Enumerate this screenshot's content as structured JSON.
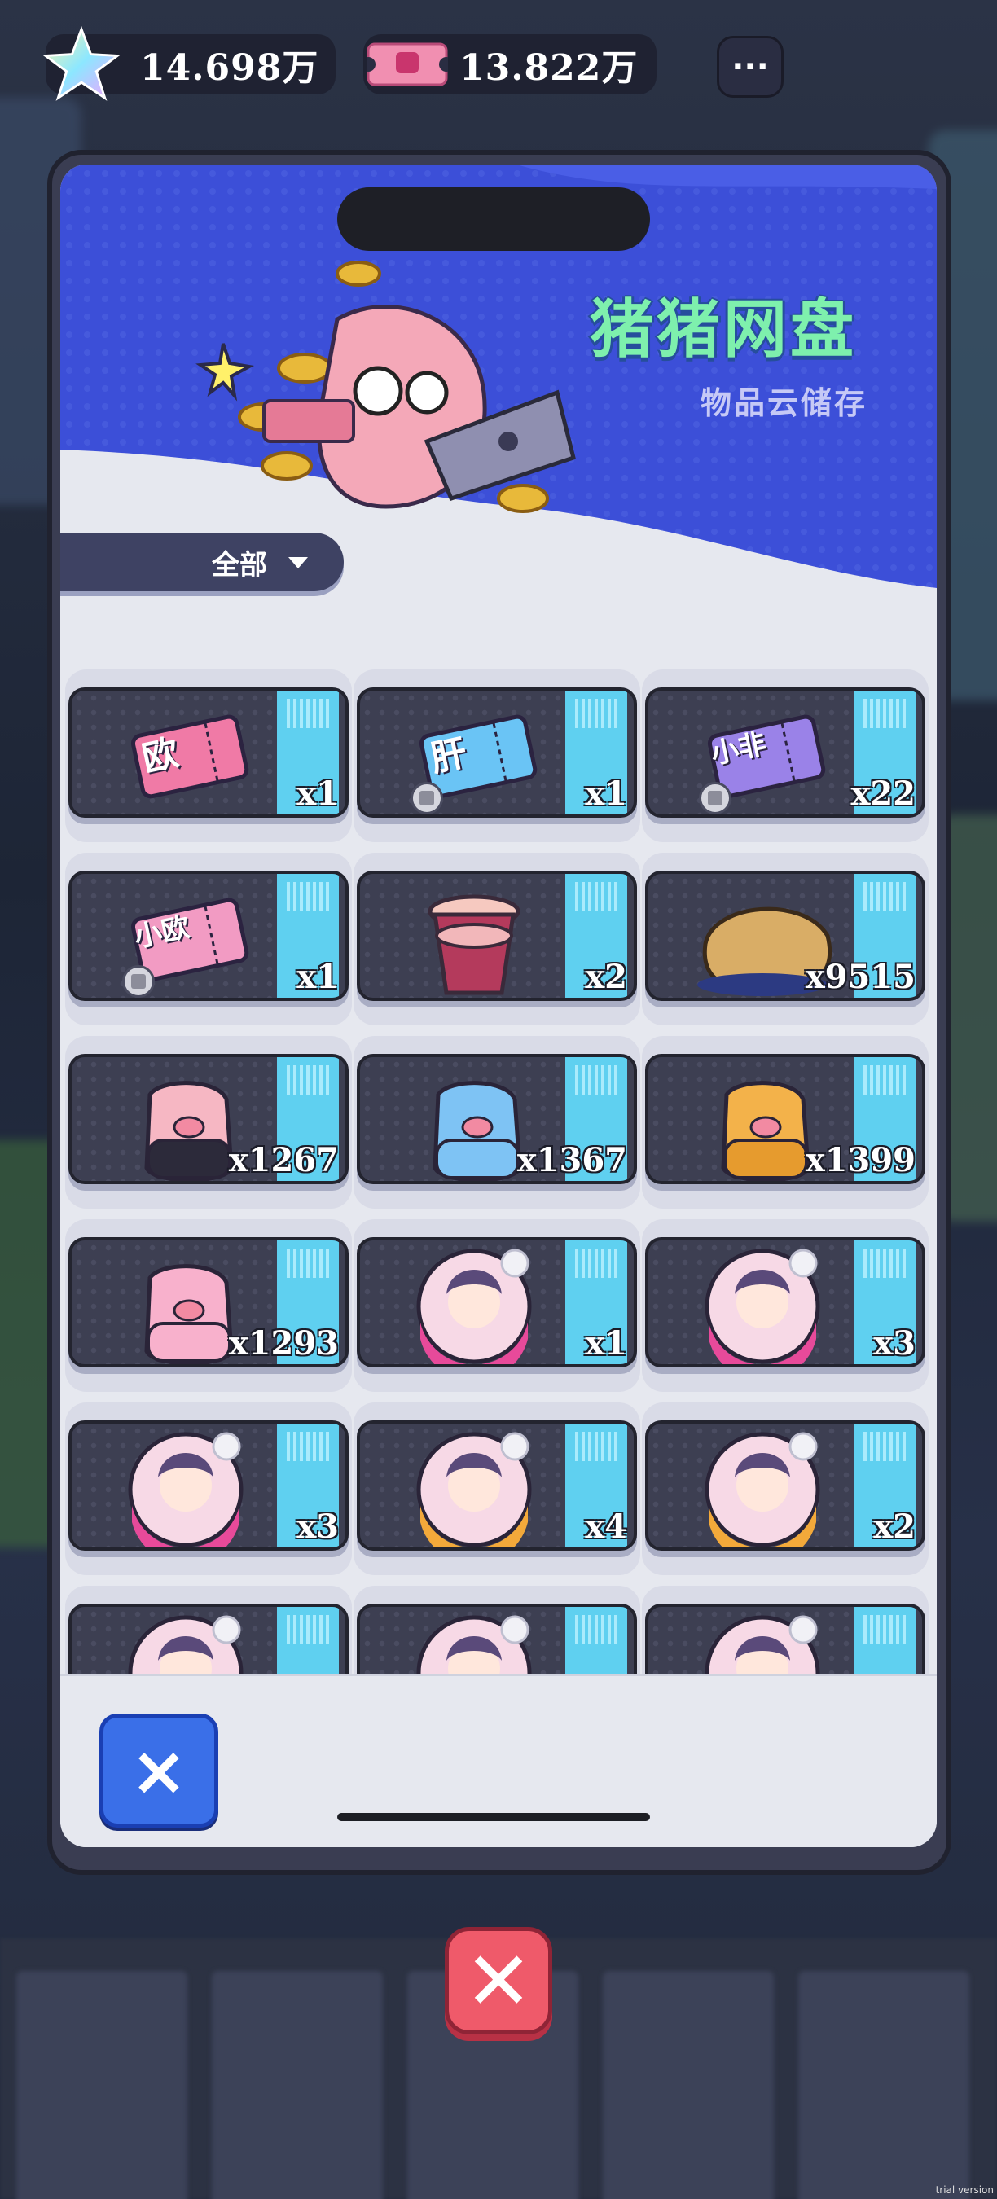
{
  "currency": {
    "stars": "14.698万",
    "tickets": "13.822万"
  },
  "more_button_label": "···",
  "panel": {
    "title": "猪猪网盘",
    "subtitle": "物品云储存",
    "filter_label": "全部"
  },
  "items": [
    {
      "name": "欧 免广 ticket",
      "qty": "x1",
      "kind": "ticket-pink",
      "ticket_text": "欧"
    },
    {
      "name": "肝 免广 ticket",
      "qty": "x1",
      "kind": "ticket-blue",
      "ticket_text": "肝"
    },
    {
      "name": "小非 免广 ticket",
      "qty": "x22",
      "kind": "ticket-purple",
      "ticket_text": "小非"
    },
    {
      "name": "小欧 免广 ticket",
      "qty": "x1",
      "kind": "ticket-lightpink",
      "ticket_text": "小欧"
    },
    {
      "name": "bubble tea",
      "qty": "x2",
      "kind": "drink"
    },
    {
      "name": "croissant",
      "qty": "x9515",
      "kind": "bread"
    },
    {
      "name": "purple pig",
      "qty": "x1267",
      "kind": "pig-purple"
    },
    {
      "name": "blue pig",
      "qty": "x1367",
      "kind": "pig-blue"
    },
    {
      "name": "yellow pig",
      "qty": "x1399",
      "kind": "pig-yellow"
    },
    {
      "name": "pink pig",
      "qty": "x1293",
      "kind": "pig-pink"
    },
    {
      "name": "character avatar",
      "qty": "x1",
      "kind": "avatar-pink"
    },
    {
      "name": "character avatar",
      "qty": "x3",
      "kind": "avatar-pink2"
    },
    {
      "name": "character avatar",
      "qty": "x3",
      "kind": "avatar-pink3"
    },
    {
      "name": "character avatar",
      "qty": "x4",
      "kind": "avatar-gold"
    },
    {
      "name": "character avatar",
      "qty": "x2",
      "kind": "avatar-gold2"
    },
    {
      "name": "character avatar",
      "qty": "",
      "kind": "avatar-pink4"
    },
    {
      "name": "character avatar",
      "qty": "",
      "kind": "avatar-gold3"
    },
    {
      "name": "character avatar",
      "qty": "",
      "kind": "avatar-gold4"
    }
  ],
  "close_small_label": "×",
  "close_big_label": "✕",
  "watermark": "trial version"
}
